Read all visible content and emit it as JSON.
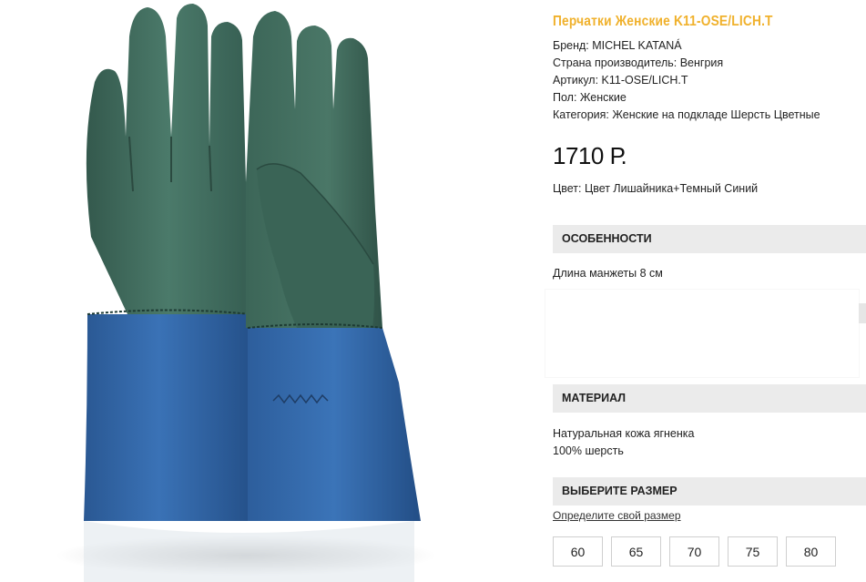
{
  "product": {
    "title": "Перчатки Женские K11-OSE/LICH.T",
    "brand": "Бренд: MICHEL KATANÁ",
    "country": "Страна производитель: Венгрия",
    "article": "Артикул: K11-OSE/LICH.T",
    "gender": "Пол: Женские",
    "category": "Категория: Женские на подкладе Шерсть Цветные",
    "price": "1710 Р.",
    "color": "Цвет: Цвет Лишайника+Темный Синий"
  },
  "features": {
    "heading": "ОСОБЕННОСТИ",
    "text": "Длина манжеты 8 см"
  },
  "material": {
    "heading": "МАТЕРИАЛ",
    "lines": [
      "Натуральная кожа ягненка",
      "100% шерсть"
    ]
  },
  "size": {
    "heading": "ВЫБЕРИТЕ РАЗМЕР",
    "link": "Определите свой размер",
    "options": [
      "60",
      "65",
      "70",
      "75",
      "80"
    ]
  },
  "colors": {
    "title": "#f0b12c",
    "glove_green": "#3f6a5c",
    "glove_blue": "#2f64a6",
    "section_bg": "#ebebeb"
  },
  "image": {
    "icon": "gloves-product-photo"
  }
}
